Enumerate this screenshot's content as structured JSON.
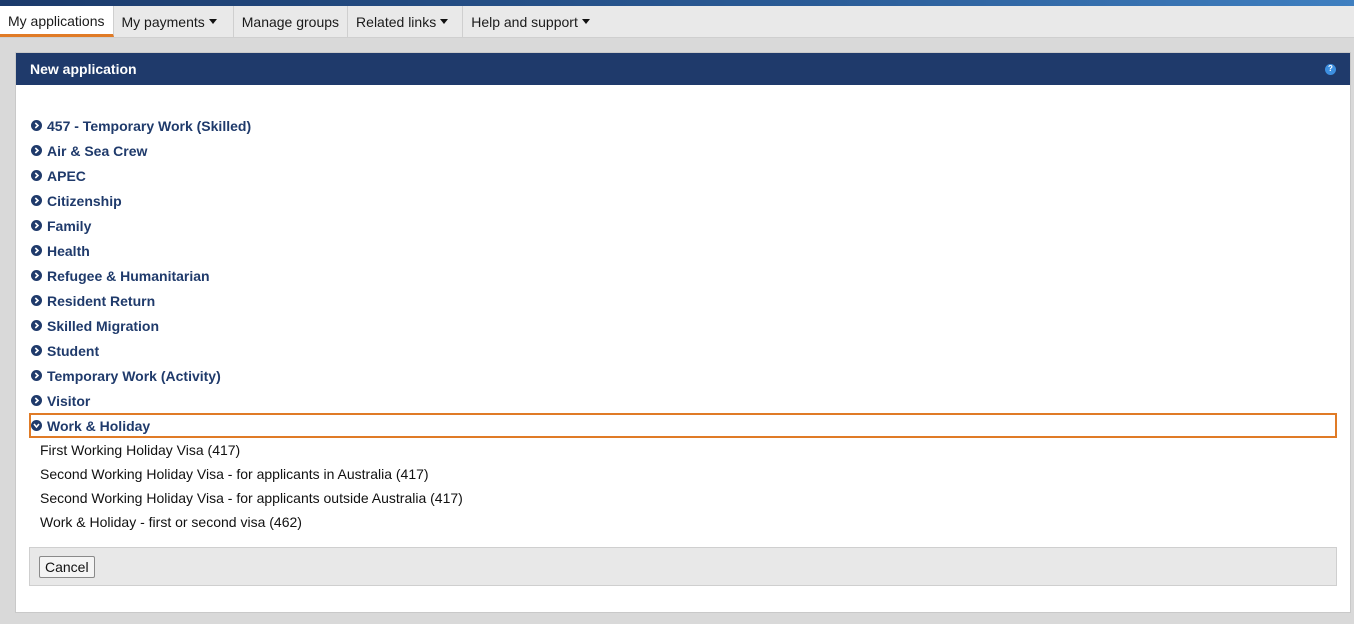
{
  "nav": {
    "items": [
      {
        "label": "My applications",
        "dropdown": false,
        "active": true
      },
      {
        "label": "My payments",
        "dropdown": true,
        "active": false
      },
      {
        "label": "Manage groups",
        "dropdown": false,
        "active": false
      },
      {
        "label": "Related links",
        "dropdown": true,
        "active": false
      },
      {
        "label": "Help and support",
        "dropdown": true,
        "active": false
      }
    ]
  },
  "panel": {
    "title": "New application",
    "help_icon": "?",
    "categories": [
      "457 - Temporary Work (Skilled)",
      "Air & Sea Crew",
      "APEC",
      "Citizenship",
      "Family",
      "Health",
      "Refugee & Humanitarian",
      "Resident Return",
      "Skilled Migration",
      "Student",
      "Temporary Work (Activity)",
      "Visitor"
    ],
    "expanded_category": "Work & Holiday",
    "subitems": [
      "First Working Holiday Visa (417)",
      "Second Working Holiday Visa - for applicants in Australia (417)",
      "Second Working Holiday Visa - for applicants outside Australia (417)",
      "Work & Holiday - first or second visa (462)"
    ],
    "cancel_label": "Cancel"
  },
  "colors": {
    "header_bg": "#1f3a6b",
    "link_text": "#1f3a6b",
    "accent_orange": "#e07b26"
  }
}
